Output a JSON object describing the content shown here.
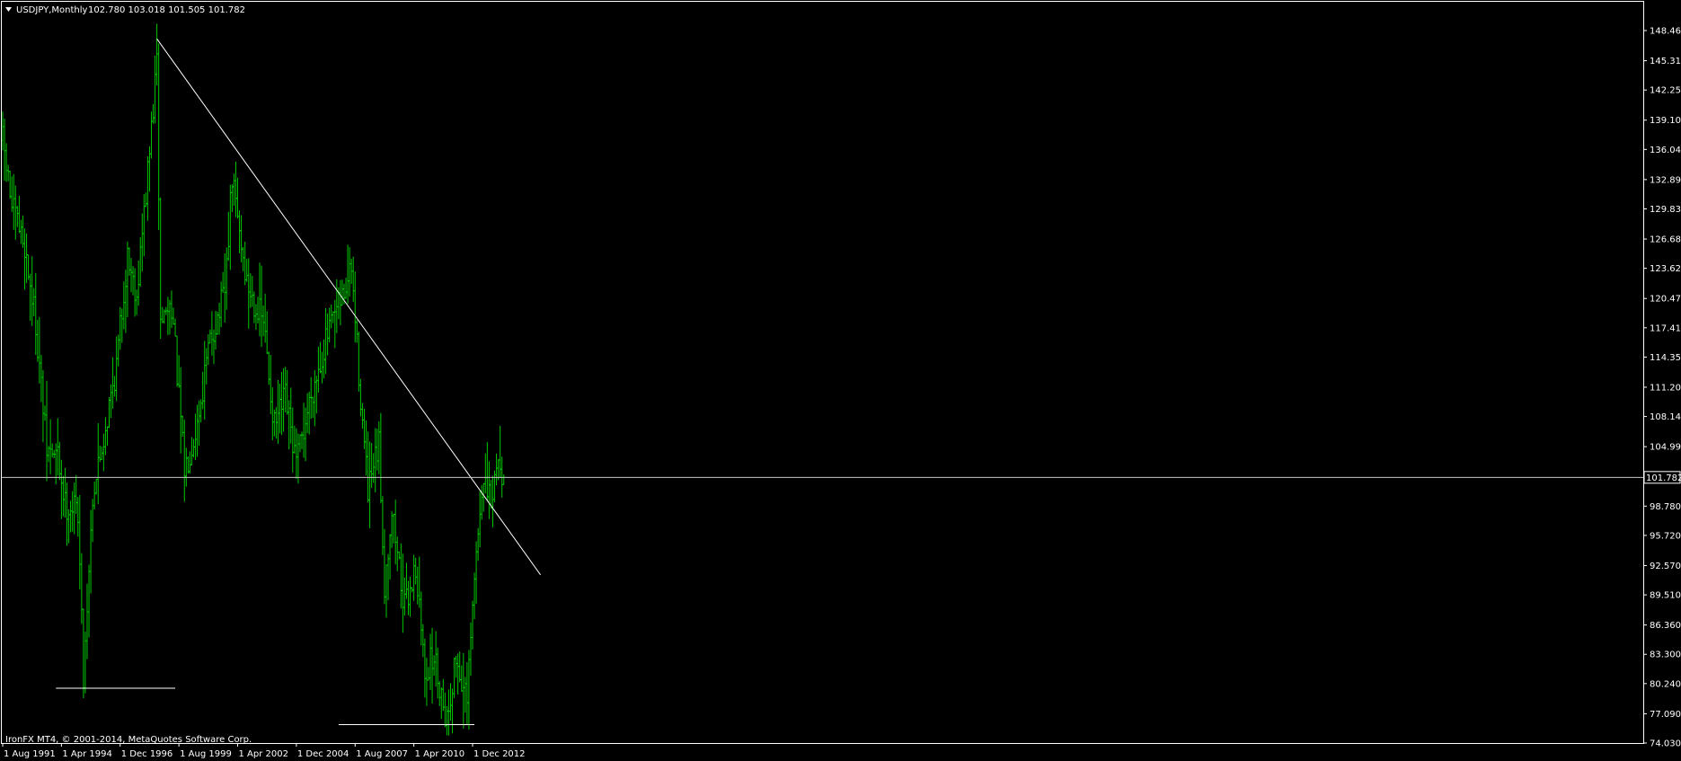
{
  "header": {
    "symbol_label": "USDJPY,Monthly",
    "ohlc_label": "102.780 103.018 101.505 101.782",
    "menu_arrow_icon": "triangle-down-icon"
  },
  "copyright": "IronFX MT4, © 2001-2014, MetaQuotes Software Corp.",
  "colors": {
    "background": "#000000",
    "bars": "#00c800",
    "lines": "#ffffff",
    "axis": "#ffffff"
  },
  "chart_data": {
    "type": "ohlc",
    "title": "USDJPY,Monthly",
    "current_price": 101.782,
    "current_price_label": "101.782",
    "ylim": [
      74.03,
      149.6
    ],
    "y_ticks": [
      "148.460",
      "145.310",
      "142.250",
      "139.100",
      "136.040",
      "132.890",
      "129.830",
      "126.680",
      "123.620",
      "120.470",
      "117.410",
      "114.350",
      "111.200",
      "108.140",
      "104.990",
      "98.780",
      "95.720",
      "92.570",
      "89.510",
      "86.360",
      "83.300",
      "80.240",
      "77.090",
      "74.030"
    ],
    "x_ticks": [
      "1 Aug 1991",
      "1 Apr 1994",
      "1 Dec 1996",
      "1 Aug 1999",
      "1 Apr 2002",
      "1 Dec 2004",
      "1 Aug 2007",
      "1 Apr 2010",
      "1 Dec 2012"
    ],
    "x_tick_dates": [
      "1991-08",
      "1994-04",
      "1996-12",
      "1999-08",
      "2002-04",
      "2004-12",
      "2007-08",
      "2010-04",
      "2012-12"
    ],
    "price_path": [
      {
        "date": "1991-08",
        "price": 137.0
      },
      {
        "date": "1992-01",
        "price": 130.0
      },
      {
        "date": "1992-08",
        "price": 126.0
      },
      {
        "date": "1993-02",
        "price": 118.0
      },
      {
        "date": "1993-08",
        "price": 104.5
      },
      {
        "date": "1994-02",
        "price": 104.0
      },
      {
        "date": "1994-06",
        "price": 99.0
      },
      {
        "date": "1995-01",
        "price": 98.5
      },
      {
        "date": "1995-04",
        "price": 81.0
      },
      {
        "date": "1995-09",
        "price": 100.0
      },
      {
        "date": "1996-04",
        "price": 107.0
      },
      {
        "date": "1996-10",
        "price": 113.5
      },
      {
        "date": "1997-04",
        "price": 125.0
      },
      {
        "date": "1997-09",
        "price": 121.0
      },
      {
        "date": "1998-03",
        "price": 133.5
      },
      {
        "date": "1998-08",
        "price": 145.0
      },
      {
        "date": "1998-10",
        "price": 118.0
      },
      {
        "date": "1999-04",
        "price": 120.0
      },
      {
        "date": "1999-11",
        "price": 102.5
      },
      {
        "date": "2000-06",
        "price": 107.5
      },
      {
        "date": "2001-01",
        "price": 116.0
      },
      {
        "date": "2001-09",
        "price": 121.0
      },
      {
        "date": "2002-01",
        "price": 133.0
      },
      {
        "date": "2002-09",
        "price": 122.0
      },
      {
        "date": "2003-06",
        "price": 118.0
      },
      {
        "date": "2003-12",
        "price": 107.0
      },
      {
        "date": "2004-06",
        "price": 110.0
      },
      {
        "date": "2004-12",
        "price": 103.0
      },
      {
        "date": "2005-08",
        "price": 110.5
      },
      {
        "date": "2006-04",
        "price": 116.0
      },
      {
        "date": "2007-01",
        "price": 120.5
      },
      {
        "date": "2007-06",
        "price": 123.5
      },
      {
        "date": "2007-11",
        "price": 110.0
      },
      {
        "date": "2008-03",
        "price": 100.0
      },
      {
        "date": "2008-09",
        "price": 105.0
      },
      {
        "date": "2008-12",
        "price": 90.5
      },
      {
        "date": "2009-04",
        "price": 98.5
      },
      {
        "date": "2009-11",
        "price": 88.0
      },
      {
        "date": "2010-05",
        "price": 92.5
      },
      {
        "date": "2010-10",
        "price": 81.5
      },
      {
        "date": "2011-03",
        "price": 83.0
      },
      {
        "date": "2011-10",
        "price": 76.5
      },
      {
        "date": "2012-03",
        "price": 83.0
      },
      {
        "date": "2012-09",
        "price": 78.0
      },
      {
        "date": "2013-01",
        "price": 91.0
      },
      {
        "date": "2013-05",
        "price": 101.0
      },
      {
        "date": "2013-11",
        "price": 99.0
      },
      {
        "date": "2014-01",
        "price": 104.0
      },
      {
        "date": "2014-05",
        "price": 101.8
      }
    ],
    "trendline": {
      "start": {
        "date": "1998-08",
        "price": 147.6
      },
      "end": {
        "date": "2016-01",
        "price": 91.6
      }
    },
    "support_lines": [
      {
        "date_start": "1994-01",
        "date_end": "1999-06",
        "price": 79.75
      },
      {
        "date_start": "2006-11",
        "date_end": "2013-01",
        "price": 75.95
      }
    ],
    "grid": false
  }
}
